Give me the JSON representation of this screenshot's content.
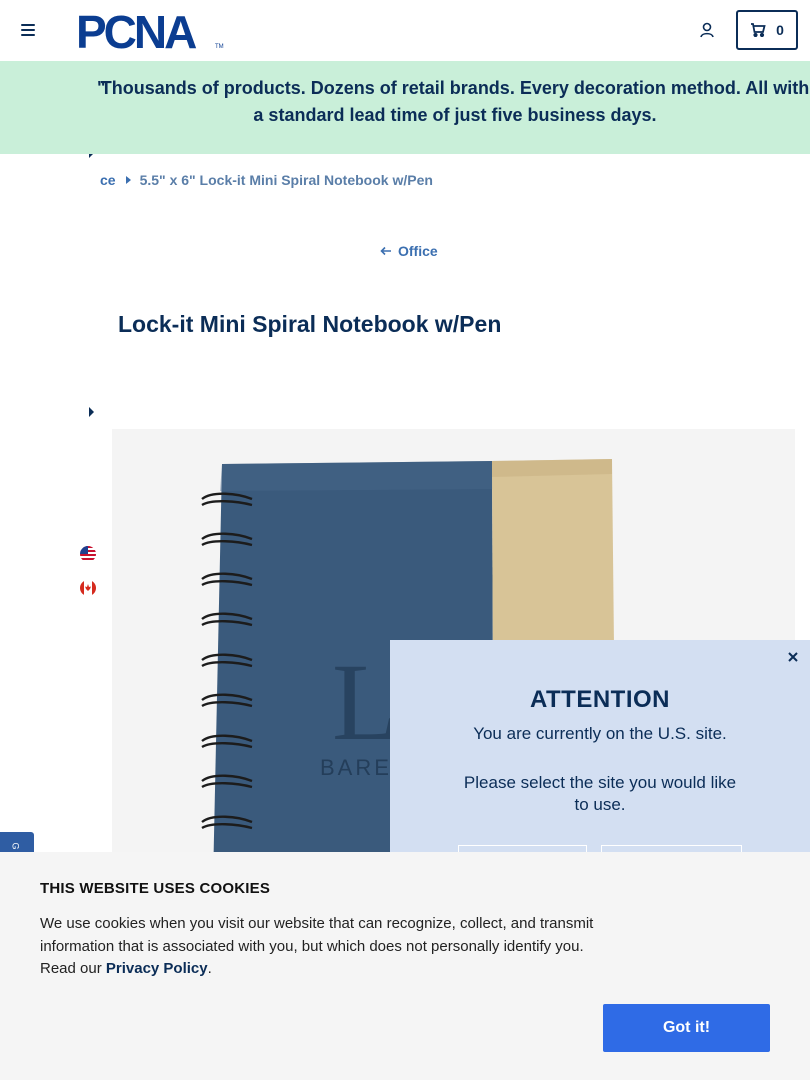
{
  "header": {
    "logo_text": "PCNA",
    "logo_tm": "TM",
    "cart_count": "0"
  },
  "banner": {
    "text": "Thousands of products. Dozens of retail brands. Every decoration method. All with a standard lead time of just five business days.",
    "leading_glyph": "\""
  },
  "breadcrumb": {
    "parent": "ce",
    "current": "5.5\" x 6\" Lock-it Mini Spiral Notebook w/Pen"
  },
  "back_link": {
    "label": "Office"
  },
  "product": {
    "title": "Lock-it Mini Spiral Notebook w/Pen",
    "image_brand_text": "BAREN"
  },
  "attention": {
    "title": "ATTENTION",
    "line1": "You are currently on the U.S. site.",
    "line2": "Please select the site you would like to use."
  },
  "side_tab": {
    "label": "G"
  },
  "cookie": {
    "title": "THIS WEBSITE USES COOKIES",
    "text": "We use cookies when you visit our website that can recognize, collect, and transmit information that is associated with you, but which does not personally identify you. Read our ",
    "link": "Privacy Policy",
    "end": ".",
    "button": "Got it!"
  },
  "colors": {
    "navy": "#0b2d57",
    "banner_bg": "#c9efd9",
    "modal_bg": "#d3dff2",
    "cookie_button": "#2f6be6",
    "link_blue": "#3b6fb0"
  }
}
